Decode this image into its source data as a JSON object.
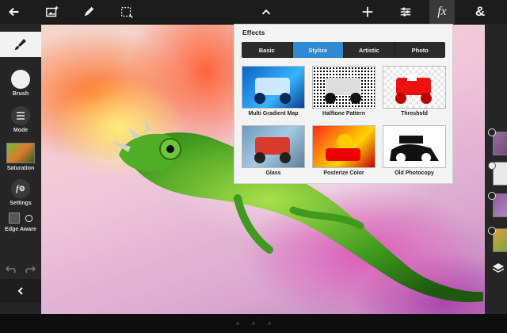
{
  "topbar": {
    "icons": [
      "back-arrow-icon",
      "image-add-icon",
      "pen-icon",
      "select-area-icon",
      "collapse-chevron-icon",
      "crosshair-icon",
      "adjust-icon",
      "fx-icon",
      "ampersand-icon"
    ],
    "fx_label": "fx",
    "amp_label": "&"
  },
  "left_toolbar": {
    "items": [
      {
        "label": "Brush"
      },
      {
        "label": "Mode"
      },
      {
        "label": "Saturation"
      },
      {
        "label": "Settings"
      },
      {
        "label": "Edge Aware"
      }
    ]
  },
  "effects_panel": {
    "title": "Effects",
    "tabs": [
      "Basic",
      "Stylize",
      "Artistic",
      "Photo"
    ],
    "active_tab": "Stylize",
    "items": [
      {
        "label": "Multi Gradient Map"
      },
      {
        "label": "Halftone Pattern"
      },
      {
        "label": "Threshold"
      },
      {
        "label": "Glass"
      },
      {
        "label": "Posterize Color"
      },
      {
        "label": "Old Photocopy"
      }
    ]
  },
  "colors": {
    "accent": "#2f8ad1",
    "toolbar": "#262626",
    "topbar": "#1c1c1c"
  }
}
